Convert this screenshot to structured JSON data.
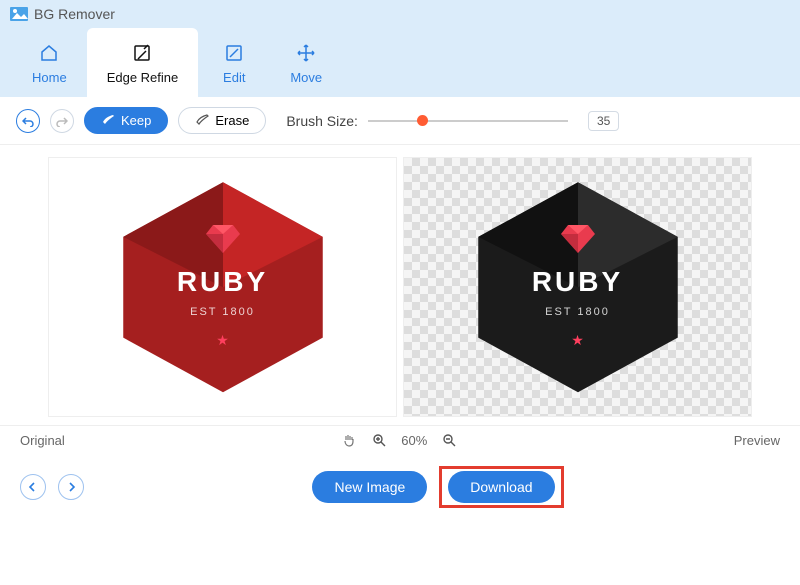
{
  "app_title": "BG Remover",
  "tabs": {
    "home": "Home",
    "edge_refine": "Edge Refine",
    "edit": "Edit",
    "move": "Move"
  },
  "toolbar": {
    "keep": "Keep",
    "erase": "Erase",
    "brush_size_label": "Brush Size:",
    "brush_size_value": "35"
  },
  "logo": {
    "title": "RUBY",
    "subtitle": "EST 1800"
  },
  "statusbar": {
    "original": "Original",
    "zoom": "60%",
    "preview": "Preview"
  },
  "footer": {
    "new_image": "New Image",
    "download": "Download"
  }
}
